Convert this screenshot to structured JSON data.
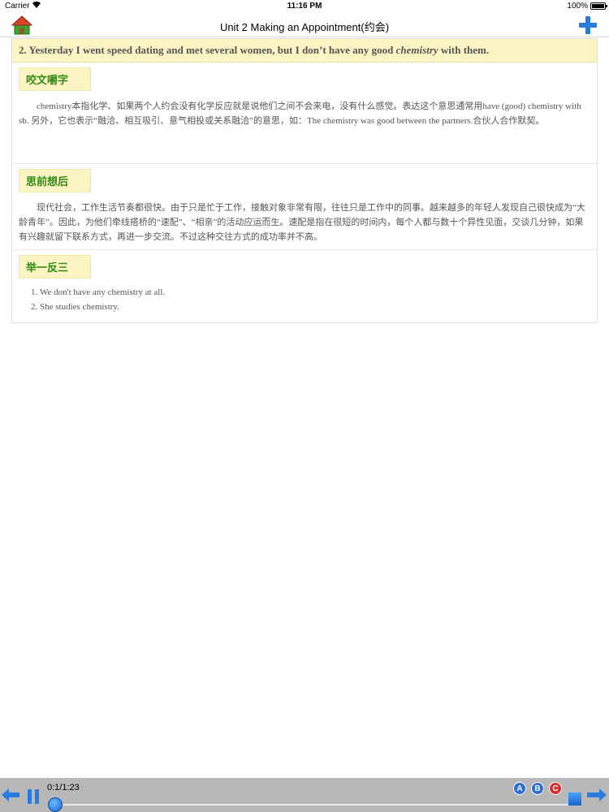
{
  "status_bar": {
    "carrier": "Carrier",
    "time": "11:16 PM",
    "battery": "100%"
  },
  "nav": {
    "title": "Unit 2 Making an Appointment(约会)",
    "home_icon": "home-icon",
    "add_icon": "plus-icon"
  },
  "question": {
    "prefix": "2. Yesterday I went speed dating and met several women, but I don’t have any good ",
    "emphasis": "chemistry",
    "suffix": " with them."
  },
  "sections": [
    {
      "tag": "咬文嚼字",
      "text": "chemistry本指化学、如果两个人约会没有化学反应就是说他们之间不会来电，没有什么感觉。表达这个意思通常用have (good) chemistry with sb. 另外，它也表示“融洽、相互吸引、意气相投或关系融洽”的意思，如：The chemistry was good between the partners.合伙人合作默契。"
    },
    {
      "tag": "思前想后",
      "text": "现代社会，工作生活节奏都很快。由于只是忙于工作，接触对象非常有限，往往只是工作中的同事。越来越多的年轻人发现自己很快成为“大龄青年”。因此，为他们牵线搭桥的“速配”、“相亲”的活动应运而生。速配是指在很短的时间内，每个人都与数十个异性见面，交谈几分钟，如果有兴趣就留下联系方式，再进一步交流。不过这种交往方式的成功率并不高。"
    },
    {
      "tag": "举一反三",
      "items": [
        "We don't have any chemistry at all.",
        "She studies chemistry."
      ]
    }
  ],
  "player": {
    "time": "0:1/1:23",
    "progress": 0.01,
    "badges": [
      "A",
      "B",
      "C"
    ]
  },
  "colors": {
    "tag_bg": "#fdf4c4",
    "tag_text": "#2e8b12",
    "player_bg": "#b8b8b8",
    "accent": "#1e7ad6"
  }
}
